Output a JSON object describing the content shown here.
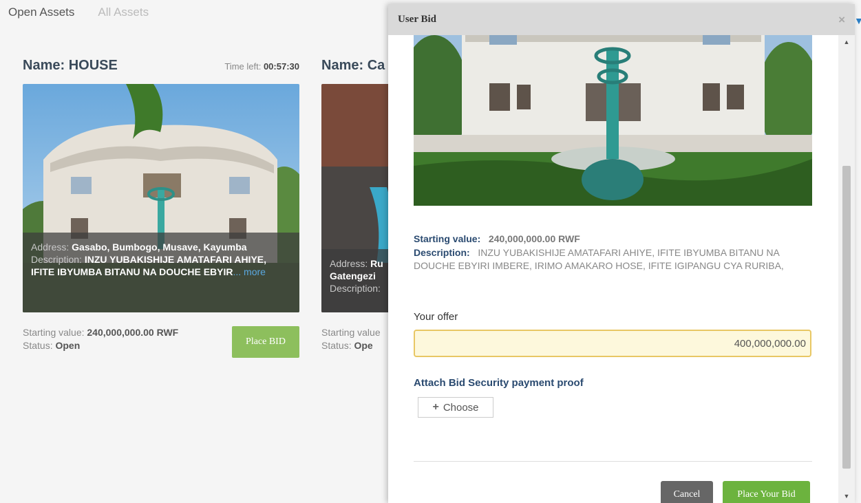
{
  "tabs": {
    "open": "Open Assets",
    "all": "All Assets"
  },
  "cards": [
    {
      "name": "Name: HOUSE",
      "time_label": "Time left:",
      "time_value": "00:57:30",
      "address_label": "Address:",
      "address": "Gasabo, Bumbogo, Musave, Kayumba",
      "description_label": "Description:",
      "description": "INZU YUBAKISHIJE AMATAFARI AHIYE, IFITE IBYUMBA BITANU NA DOUCHE EBYIR",
      "more": "... more",
      "starting_label": "Starting value:",
      "starting_value": "240,000,000.00",
      "currency": "RWF",
      "status_label": "Status:",
      "status": "Open",
      "button": "Place BID"
    },
    {
      "name": "Name: Ca",
      "address_label": "Address:",
      "address": "Ru",
      "address_line2": "Gatengezi",
      "description_label": "Description:",
      "starting_label": "Starting value",
      "status_label": "Status:",
      "status": "Ope"
    }
  ],
  "modal": {
    "title": "User Bid",
    "close": "×",
    "starting_label": "Starting value:",
    "starting_value": "240,000,000.00",
    "currency": "RWF",
    "description_label": "Description:",
    "description": "INZU YUBAKISHIJE AMATAFARI AHIYE, IFITE IBYUMBA BITANU NA DOUCHE EBYIRI IMBERE, IRIMO AMAKARO HOSE, IFITE IGIPANGU CYA RURIBA,",
    "offer_label": "Your offer",
    "offer_value": "400,000,000.00",
    "attach_label": "Attach Bid Security payment proof",
    "choose_label": "Choose",
    "cancel_label": "Cancel",
    "submit_label": "Place Your Bid"
  },
  "icons": {
    "close": "close-icon",
    "plus": "plus-icon",
    "scroll_up": "arrow-up-icon",
    "scroll_down": "arrow-down-icon"
  },
  "colors": {
    "primary_green": "#6cb33e",
    "bid_button": "#8dbf5d",
    "cancel": "#666666",
    "input_highlight": "#fdf8dc",
    "input_border": "#e8c764",
    "heading": "#3a4a5a"
  }
}
